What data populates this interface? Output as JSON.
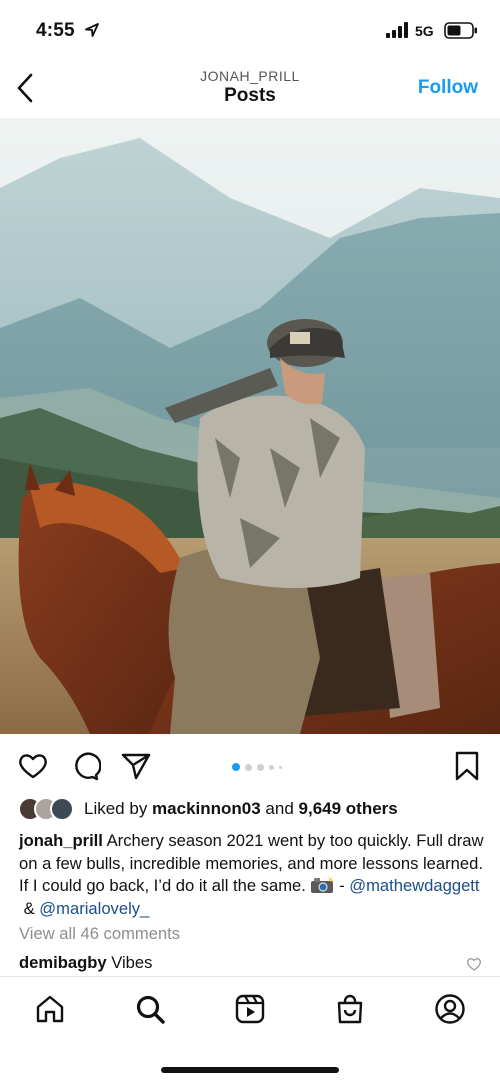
{
  "status": {
    "time": "4:55",
    "network": "5G"
  },
  "nav": {
    "username": "JONAH_PRILL",
    "title": "Posts",
    "follow_label": "Follow"
  },
  "post": {
    "image_alt": "Hunter in camo jacket and cap on horseback drinking from a bottle, mountains in background",
    "carousel": {
      "count": 5,
      "active_index": 0
    },
    "likes": {
      "prefix": "Liked by ",
      "first_user": "mackinnon03",
      "middle": " and ",
      "others": "9,649 others"
    },
    "caption": {
      "user": "jonah_prill",
      "text": " Archery season 2021 went by too quickly. Full draw on a few bulls, incredible memories, and more lessons learned. If I could go back, I’d do it all the same. ",
      "dash": " - ",
      "mention1": "@mathewdaggett",
      "amp": " & ",
      "mention2": "@marialovely_"
    },
    "view_all_comments": "View all 46 comments",
    "top_comment": {
      "user": "demibagby",
      "text": " Vibes"
    }
  },
  "icons": {
    "like": "heart-icon",
    "comment": "comment-icon",
    "share": "send-icon",
    "save": "bookmark-icon",
    "tabs": [
      "home-icon",
      "search-icon",
      "reels-icon",
      "shop-icon",
      "profile-icon"
    ]
  },
  "colors": {
    "accent": "#1a9bf0",
    "mention": "#1b4f8c",
    "muted": "#8e8e8e"
  }
}
